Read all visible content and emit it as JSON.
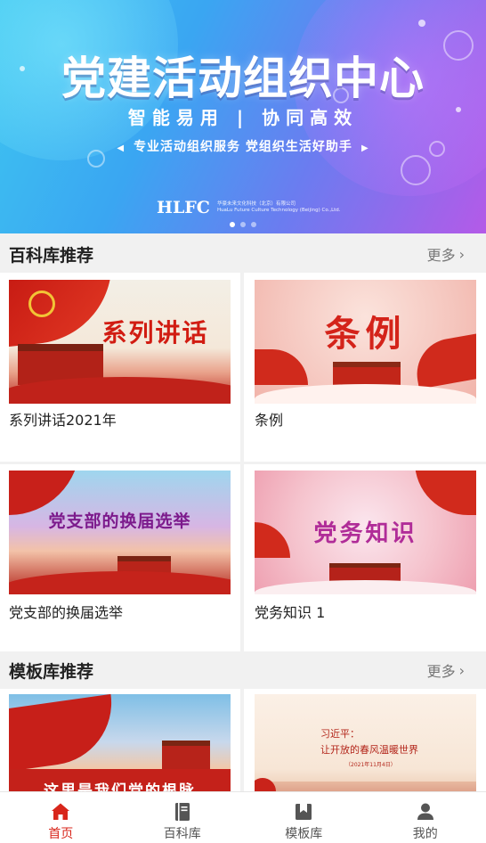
{
  "banner": {
    "title": "党建活动组织中心",
    "subtitle": "智能易用 | 协同高效",
    "tagline": "专业活动组织服务  党组织生活好助手",
    "brand_logo": "HLFC",
    "brand_company_cn": "华豪未来文化科技（北京）有限公司",
    "brand_company_en": "HuaLu Future Culture Technology (Beijing) Co.,Ltd."
  },
  "sections": {
    "encyclopedia": {
      "title": "百科库推荐",
      "more": "更多",
      "items": [
        {
          "label": "系列讲话2021年",
          "thumb_text": "系列讲话"
        },
        {
          "label": "条例",
          "thumb_text": "条例"
        },
        {
          "label": "党支部的换届选举",
          "thumb_text": "党支部的换届选举"
        },
        {
          "label": "党务知识 1",
          "thumb_text": "党务知识"
        }
      ]
    },
    "templates": {
      "title": "模板库推荐",
      "more": "更多",
      "items": [
        {
          "thumb_text": "这里是我们党的根脉"
        },
        {
          "thumb_line1": "习近平：",
          "thumb_line2": "让开放的春风温暖世界",
          "thumb_line3": "（2021年11月4日）"
        }
      ]
    }
  },
  "tabbar": {
    "items": [
      {
        "label": "首页",
        "icon": "home-icon",
        "active": true
      },
      {
        "label": "百科库",
        "icon": "book-icon",
        "active": false
      },
      {
        "label": "模板库",
        "icon": "bookmark-icon",
        "active": false
      },
      {
        "label": "我的",
        "icon": "user-icon",
        "active": false
      }
    ]
  },
  "colors": {
    "accent": "#d8261b",
    "banner_start": "#3ec6f0",
    "banner_end": "#b45ae8"
  }
}
